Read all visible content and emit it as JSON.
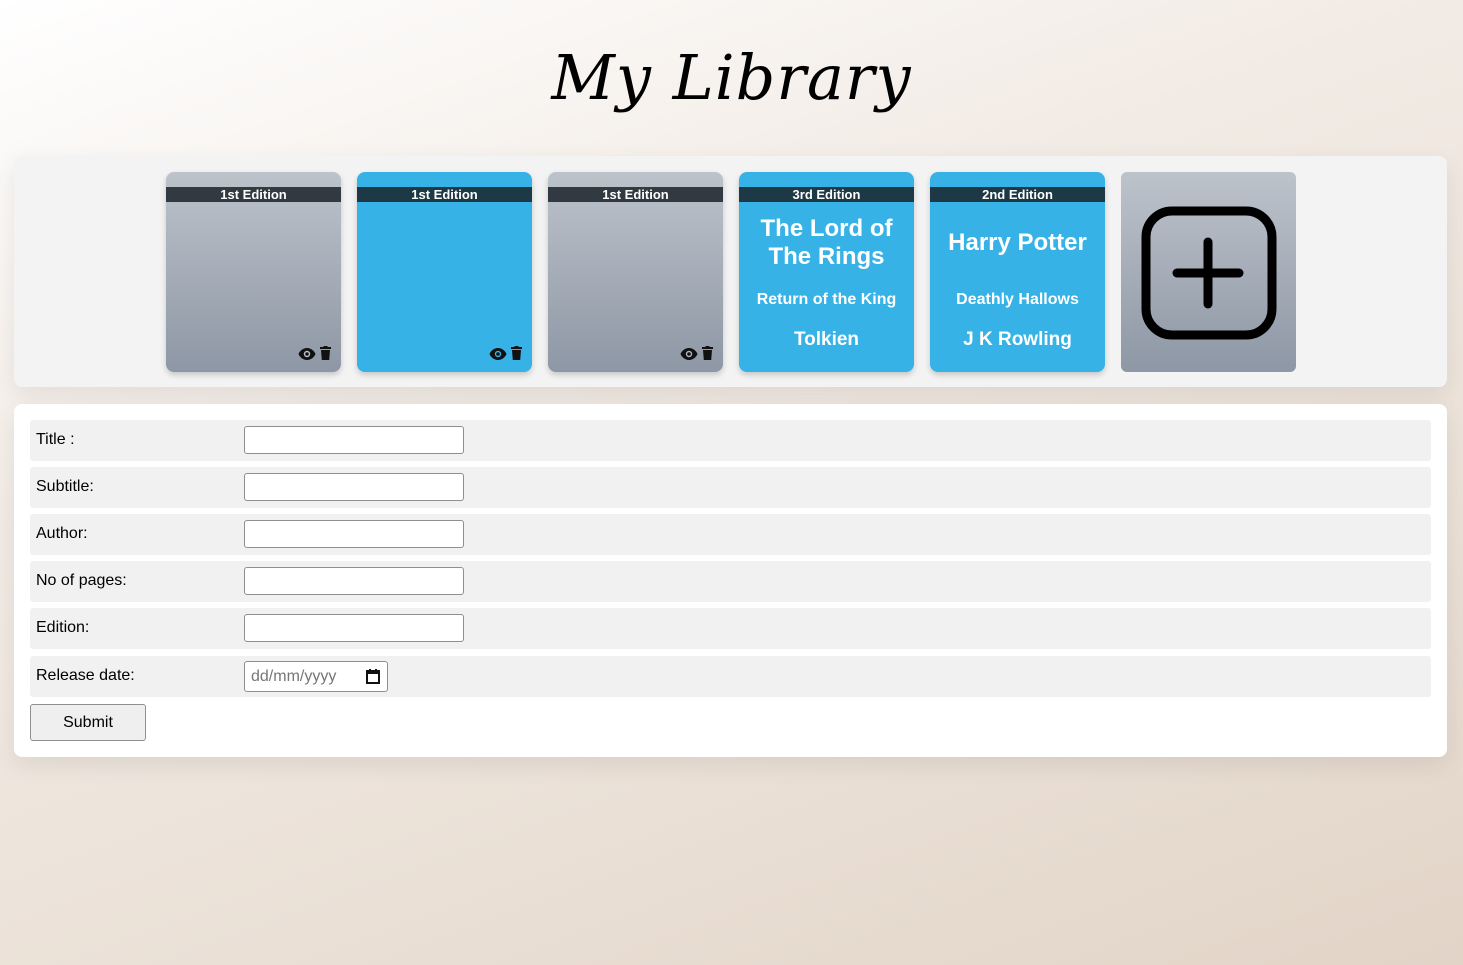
{
  "header": {
    "title": "My Library"
  },
  "books": [
    {
      "edition": "1st Edition",
      "title": "",
      "subtitle": "",
      "author": "",
      "color": "grey",
      "actions": [
        "eye-icon",
        "trash-icon"
      ]
    },
    {
      "edition": "1st Edition",
      "title": "",
      "subtitle": "",
      "author": "",
      "color": "blue",
      "actions": [
        "eye-icon",
        "trash-icon"
      ]
    },
    {
      "edition": "1st Edition",
      "title": "",
      "subtitle": "",
      "author": "",
      "color": "grey",
      "actions": [
        "eye-icon",
        "trash-icon"
      ]
    },
    {
      "edition": "3rd Edition",
      "title": "The Lord of The Rings",
      "subtitle": "Return of the King",
      "author": "Tolkien",
      "color": "blue"
    },
    {
      "edition": "2nd Edition",
      "title": "Harry Potter",
      "subtitle": "Deathly Hallows",
      "author": "J K Rowling",
      "color": "blue"
    }
  ],
  "add_card": {
    "icon": "plus-square-icon"
  },
  "form": {
    "title_label": "Title :",
    "title_value": "",
    "subtitle_label": "Subtitle:",
    "subtitle_value": "",
    "author_label": "Author:",
    "author_value": "",
    "pages_label": "No of pages:",
    "pages_value": "",
    "edition_label": "Edition:",
    "edition_value": "",
    "release_label": "Release date:",
    "release_placeholder": "dd/mm/yyyy",
    "submit_label": "Submit"
  },
  "colors": {
    "book_blue": "#36b2e6",
    "book_grey": "#8e97a5",
    "edition_band": "#1c262b"
  }
}
